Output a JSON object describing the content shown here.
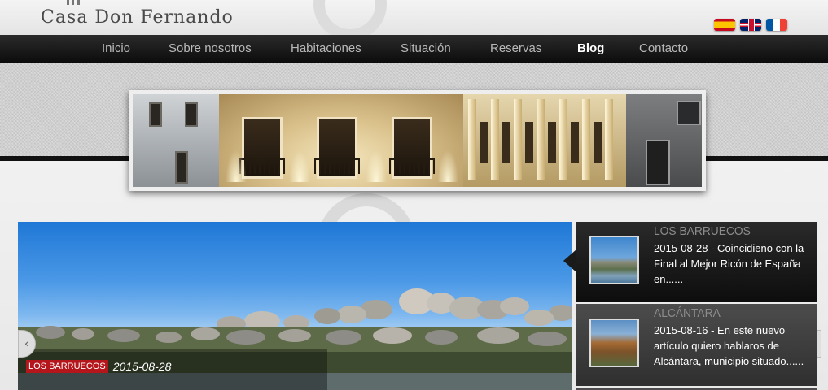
{
  "header": {
    "logo_text": "Casa Don Fernando",
    "flags": [
      {
        "name": "flag-es-icon",
        "lang": "Español"
      },
      {
        "name": "flag-gb-icon",
        "lang": "English"
      },
      {
        "name": "flag-fr-icon",
        "lang": "Français"
      }
    ]
  },
  "nav": {
    "items": [
      {
        "label": "Inicio"
      },
      {
        "label": "Sobre nosotros"
      },
      {
        "label": "Habitaciones"
      },
      {
        "label": "Situación"
      },
      {
        "label": "Reservas"
      },
      {
        "label": "Blog",
        "active": true
      },
      {
        "label": "Contacto"
      }
    ]
  },
  "slider": {
    "category": "LOS BARRUECOS",
    "date": "2015-08-28",
    "prev_icon": "chevron-left-icon",
    "next_icon": "chevron-right-icon"
  },
  "posts": [
    {
      "title": "LOS BARRUECOS",
      "excerpt": "2015-08-28 - Coincidieno con la Final al Mejor Ricón de España en......"
    },
    {
      "title": "ALCÁNTARA",
      "excerpt": "2015-08-16 - En este nuevo artículo quiero hablaros de Alcántara, municipio situado......"
    }
  ],
  "colors": {
    "nav_bg": "#111111",
    "nav_active": "#ffffff",
    "nav_text": "#b9b9b9",
    "badge": "#b4161b",
    "side_title": "#8c8c8c"
  }
}
